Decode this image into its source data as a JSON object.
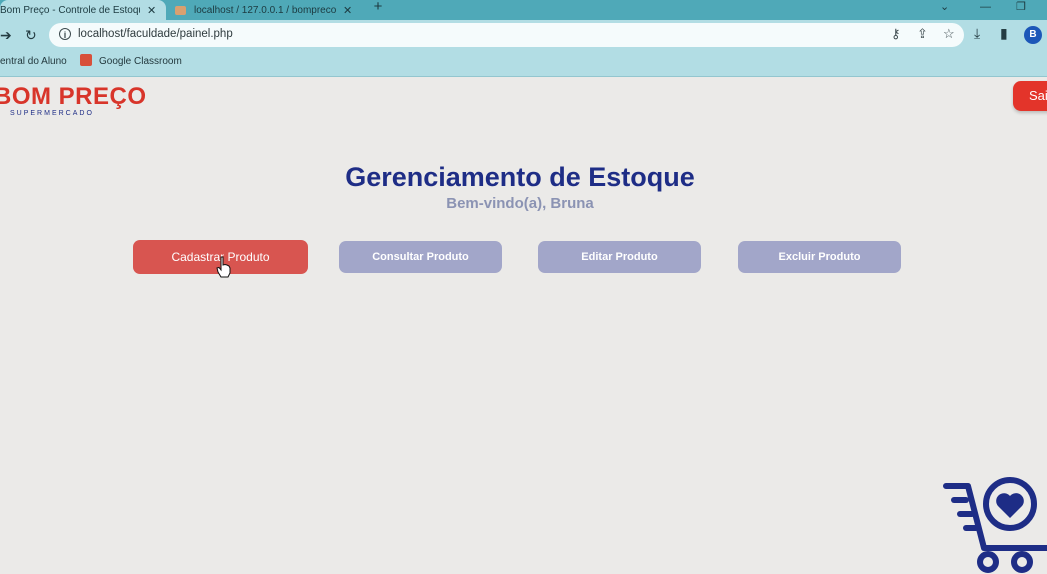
{
  "browser": {
    "tabs": [
      {
        "title": "Bom Preço - Controle de Estoque",
        "close": "✕"
      },
      {
        "title": "localhost / 127.0.0.1 / bompreco",
        "close": "✕"
      }
    ],
    "new_tab": "+",
    "url": "localhost/faculdade/painel.php",
    "avatar_letter": "B",
    "bookmarks": [
      "entral do Aluno",
      "Google Classroom"
    ]
  },
  "header": {
    "logo_main": "BOM PREÇO",
    "logo_sub": "SUPERMERCADO",
    "logout_label": "Sair"
  },
  "main": {
    "title": "Gerenciamento de Estoque",
    "welcome": "Bem-vindo(a), Bruna",
    "buttons": [
      "Cadastrar Produto",
      "Consultar Produto",
      "Editar Produto",
      "Excluir Produto"
    ]
  },
  "colors": {
    "brand_red": "#d8352a",
    "brand_navy": "#1e2d86",
    "primary_button": "#d85550",
    "muted_button": "#a2a6c9",
    "browser_frame": "#b2dde4"
  },
  "icons": [
    "back-arrow-icon",
    "reload-icon",
    "info-icon",
    "key-icon",
    "share-icon",
    "star-icon",
    "download-icon",
    "sidebar-icon",
    "shopping-cart-heart-icon"
  ]
}
